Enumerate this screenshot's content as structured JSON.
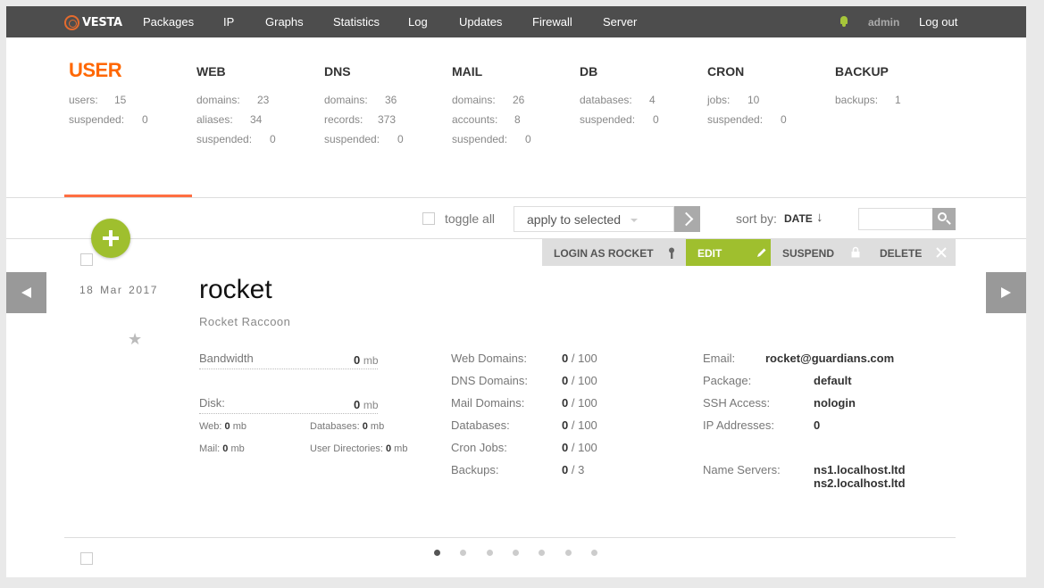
{
  "brand": {
    "name": "VESTA",
    "accent": "#ff6701",
    "green": "#9fbf2e"
  },
  "nav": {
    "items": [
      "Packages",
      "IP",
      "Graphs",
      "Statistics",
      "Log",
      "Updates",
      "Firewall",
      "Server"
    ],
    "user": "admin",
    "logout": "Log out"
  },
  "stats": {
    "user": {
      "title": "USER",
      "users_label": "users:",
      "users": "15",
      "suspended_label": "suspended:",
      "suspended": "0"
    },
    "web": {
      "title": "WEB",
      "domains_label": "domains:",
      "domains": "23",
      "aliases_label": "aliases:",
      "aliases": "34",
      "suspended_label": "suspended:",
      "suspended": "0"
    },
    "dns": {
      "title": "DNS",
      "domains_label": "domains:",
      "domains": "36",
      "records_label": "records:",
      "records": "373",
      "suspended_label": "suspended:",
      "suspended": "0"
    },
    "mail": {
      "title": "MAIL",
      "domains_label": "domains:",
      "domains": "26",
      "accounts_label": "accounts:",
      "accounts": "8",
      "suspended_label": "suspended:",
      "suspended": "0"
    },
    "db": {
      "title": "DB",
      "databases_label": "databases:",
      "databases": "4",
      "suspended_label": "suspended:",
      "suspended": "0"
    },
    "cron": {
      "title": "CRON",
      "jobs_label": "jobs:",
      "jobs": "10",
      "suspended_label": "suspended:",
      "suspended": "0"
    },
    "backup": {
      "title": "BACKUP",
      "backups_label": "backups:",
      "backups": "1"
    }
  },
  "toolbar": {
    "toggle_all": "toggle all",
    "apply_selected": "apply to selected",
    "sort_label": "sort by:",
    "sort_value": "DATE",
    "sort_arrow": "↓",
    "search_placeholder": ""
  },
  "actions": {
    "login": "LOGIN AS ROCKET",
    "edit": "EDIT",
    "suspend": "SUSPEND",
    "delete": "DELETE"
  },
  "user": {
    "date": "18 Mar 2017",
    "star": "★",
    "name": "rocket",
    "full_name": "Rocket Raccoon",
    "bandwidth_label": "Bandwidth",
    "bandwidth": "0",
    "disk_label": "Disk:",
    "disk": "0",
    "unit": "mb",
    "web_label": "Web:",
    "web": "0",
    "databases_label": "Databases:",
    "databases": "0",
    "mail_label": "Mail:",
    "mail": "0",
    "userdirs_label": "User Directories:",
    "userdirs": "0",
    "limits": [
      {
        "label": "Web Domains:",
        "used": "0",
        "limit": "/ 100"
      },
      {
        "label": "DNS Domains:",
        "used": "0",
        "limit": "/ 100"
      },
      {
        "label": "Mail Domains:",
        "used": "0",
        "limit": "/ 100"
      },
      {
        "label": "Databases:",
        "used": "0",
        "limit": "/ 100"
      },
      {
        "label": "Cron Jobs:",
        "used": "0",
        "limit": "/ 100"
      },
      {
        "label": "Backups:",
        "used": "0",
        "limit": "/ 3"
      }
    ],
    "email_label": "Email:",
    "email": "rocket@guardians.com",
    "package_label": "Package:",
    "package": "default",
    "ssh_label": "SSH Access:",
    "ssh": "nologin",
    "ip_label": "IP Addresses:",
    "ip": "0",
    "ns_label": "Name Servers:",
    "ns1": "ns1.localhost.ltd",
    "ns2": "ns2.localhost.ltd"
  },
  "pager": {
    "count": 7,
    "active": 1
  }
}
